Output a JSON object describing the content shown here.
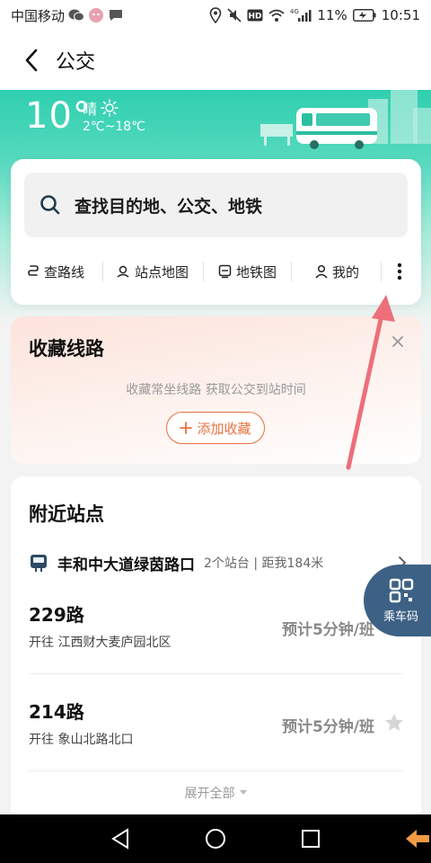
{
  "status_bar": {
    "carrier": "中国移动",
    "network": "4G",
    "battery": "11%",
    "time": "10:51",
    "icons": [
      "wechat-icon",
      "app-notification-icon",
      "message-icon",
      "location-icon",
      "mute-icon",
      "hd-icon",
      "wifi-icon",
      "signal-icon",
      "battery-icon"
    ]
  },
  "header": {
    "title": "公交"
  },
  "weather": {
    "temperature": "10°",
    "condition": "晴",
    "range": "2℃~18℃"
  },
  "search": {
    "placeholder": "查找目的地、公交、地铁"
  },
  "quick_actions": [
    {
      "label": "查路线",
      "icon": "route-icon"
    },
    {
      "label": "站点地图",
      "icon": "station-map-icon"
    },
    {
      "label": "地铁图",
      "icon": "subway-map-icon"
    },
    {
      "label": "我的",
      "icon": "user-icon"
    }
  ],
  "favorites": {
    "title": "收藏线路",
    "description": "收藏常坐线路 获取公交到站时间",
    "add_label": "添加收藏"
  },
  "nearby": {
    "title": "附近站点",
    "station": {
      "name": "丰和中大道绿茵路口",
      "meta": "2个站台 | 距我184米"
    },
    "routes": [
      {
        "name": "229路",
        "destination": "开往 江西财大麦庐园北区",
        "eta": "预计5分钟/班"
      },
      {
        "name": "214路",
        "destination": "开往 象山北路北口",
        "eta": "预计5分钟/班"
      }
    ],
    "expand_label": "展开全部"
  },
  "ride_code": {
    "label": "乘车码"
  },
  "colors": {
    "accent_teal": "#2fcfb0",
    "accent_orange": "#e8703f",
    "ride_code_bg": "#3d6185",
    "annotation_arrow": "#ec6f7a"
  }
}
